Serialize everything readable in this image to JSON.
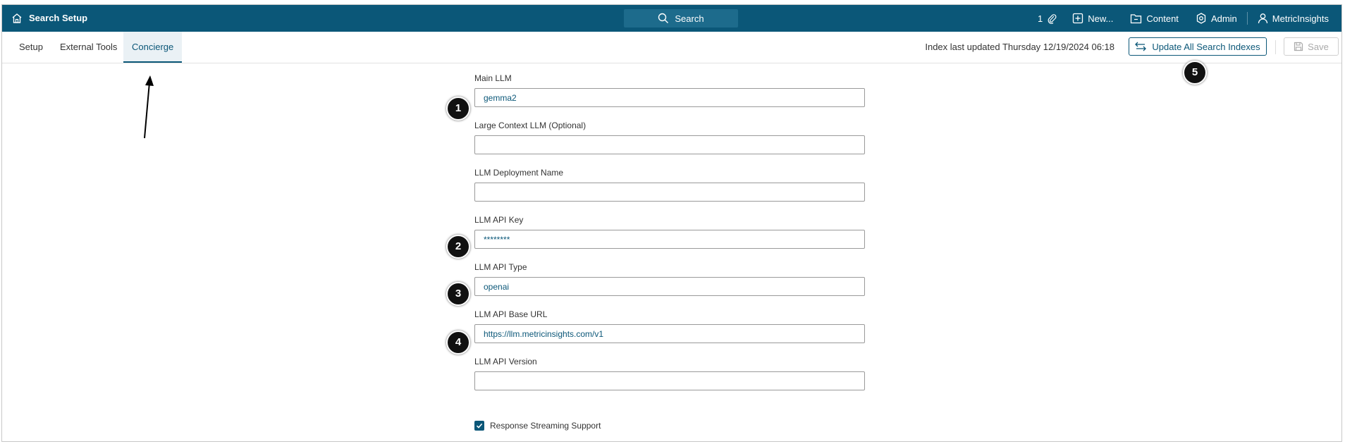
{
  "topbar": {
    "title": "Search Setup",
    "search_label": "Search",
    "attachments_count": "1",
    "new_label": "New...",
    "content_label": "Content",
    "admin_label": "Admin",
    "user_label": "MetricInsights"
  },
  "subnav": {
    "tabs": [
      {
        "label": "Setup"
      },
      {
        "label": "External Tools"
      },
      {
        "label": "Concierge",
        "active": true
      }
    ],
    "index_status": "Index last updated Thursday 12/19/2024 06:18",
    "update_label": "Update All Search Indexes",
    "save_label": "Save"
  },
  "form": {
    "fields": [
      {
        "label": "Main LLM",
        "value": "gemma2"
      },
      {
        "label": "Large Context LLM (Optional)",
        "value": ""
      },
      {
        "label": "LLM Deployment Name",
        "value": ""
      },
      {
        "label": "LLM API Key",
        "value": "********"
      },
      {
        "label": "LLM API Type",
        "value": "openai"
      },
      {
        "label": "LLM API Base URL",
        "value": "https://llm.metricinsights.com/v1"
      },
      {
        "label": "LLM API Version",
        "value": ""
      }
    ],
    "streaming_label": "Response Streaming Support",
    "streaming_checked": true
  },
  "callouts": [
    "1",
    "2",
    "3",
    "4",
    "5"
  ],
  "colors": {
    "brand": "#0b5778",
    "callout": "#111111"
  },
  "icons": {
    "home": "home-icon",
    "search": "search-icon",
    "attachment": "paperclip-icon",
    "new": "plus-square-icon",
    "content": "folder-icon",
    "admin": "gear-icon",
    "user": "user-icon",
    "update": "swap-arrows-icon",
    "save": "floppy-icon",
    "check": "checkmark-icon"
  }
}
